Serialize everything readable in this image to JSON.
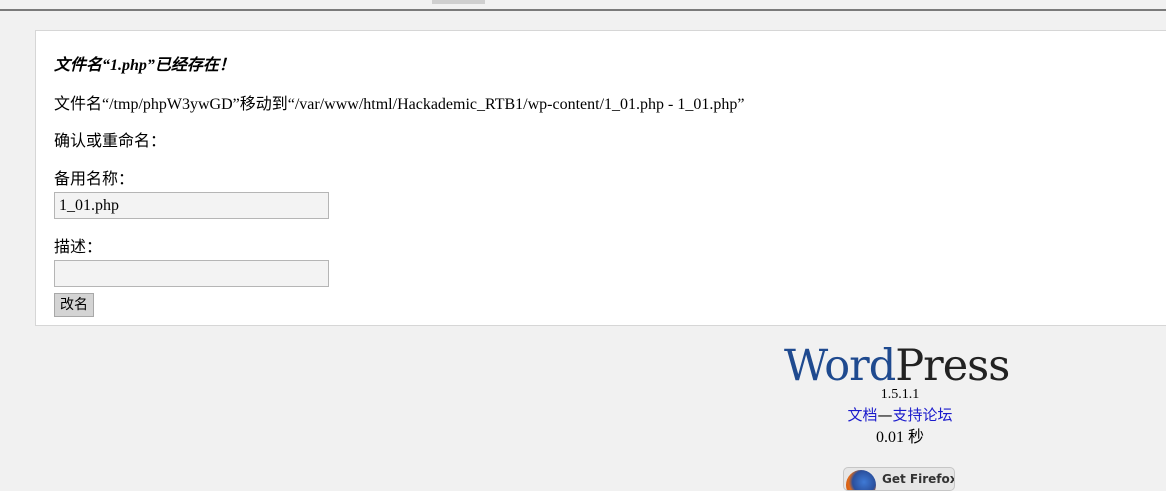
{
  "upload_notice": {
    "exists_message": "文件名“1.php”已经存在！",
    "moved_message": "文件名“/tmp/phpW3ywGD”移动到“/var/www/html/Hackademic_RTB1/wp-content/1_01.php - 1_01.php”",
    "confirm_prompt": "确认或重命名："
  },
  "form": {
    "alt_name_label": "备用名称：",
    "alt_name_value": "1_01.php",
    "description_label": "描述：",
    "description_value": "",
    "rename_button_label": "改名"
  },
  "footer": {
    "logo_word": "Word",
    "logo_press": "Press",
    "version": "1.5.1.1",
    "docs_link": "文档",
    "separator": "—",
    "support_link": "支持论坛",
    "timing": "0.01 秒",
    "firefox_badge_text": "Get Firefox"
  },
  "colors": {
    "background": "#f1f1f1",
    "panel": "#ffffff",
    "link": "#1a1acc",
    "logo_blue": "#1f4a8f"
  }
}
